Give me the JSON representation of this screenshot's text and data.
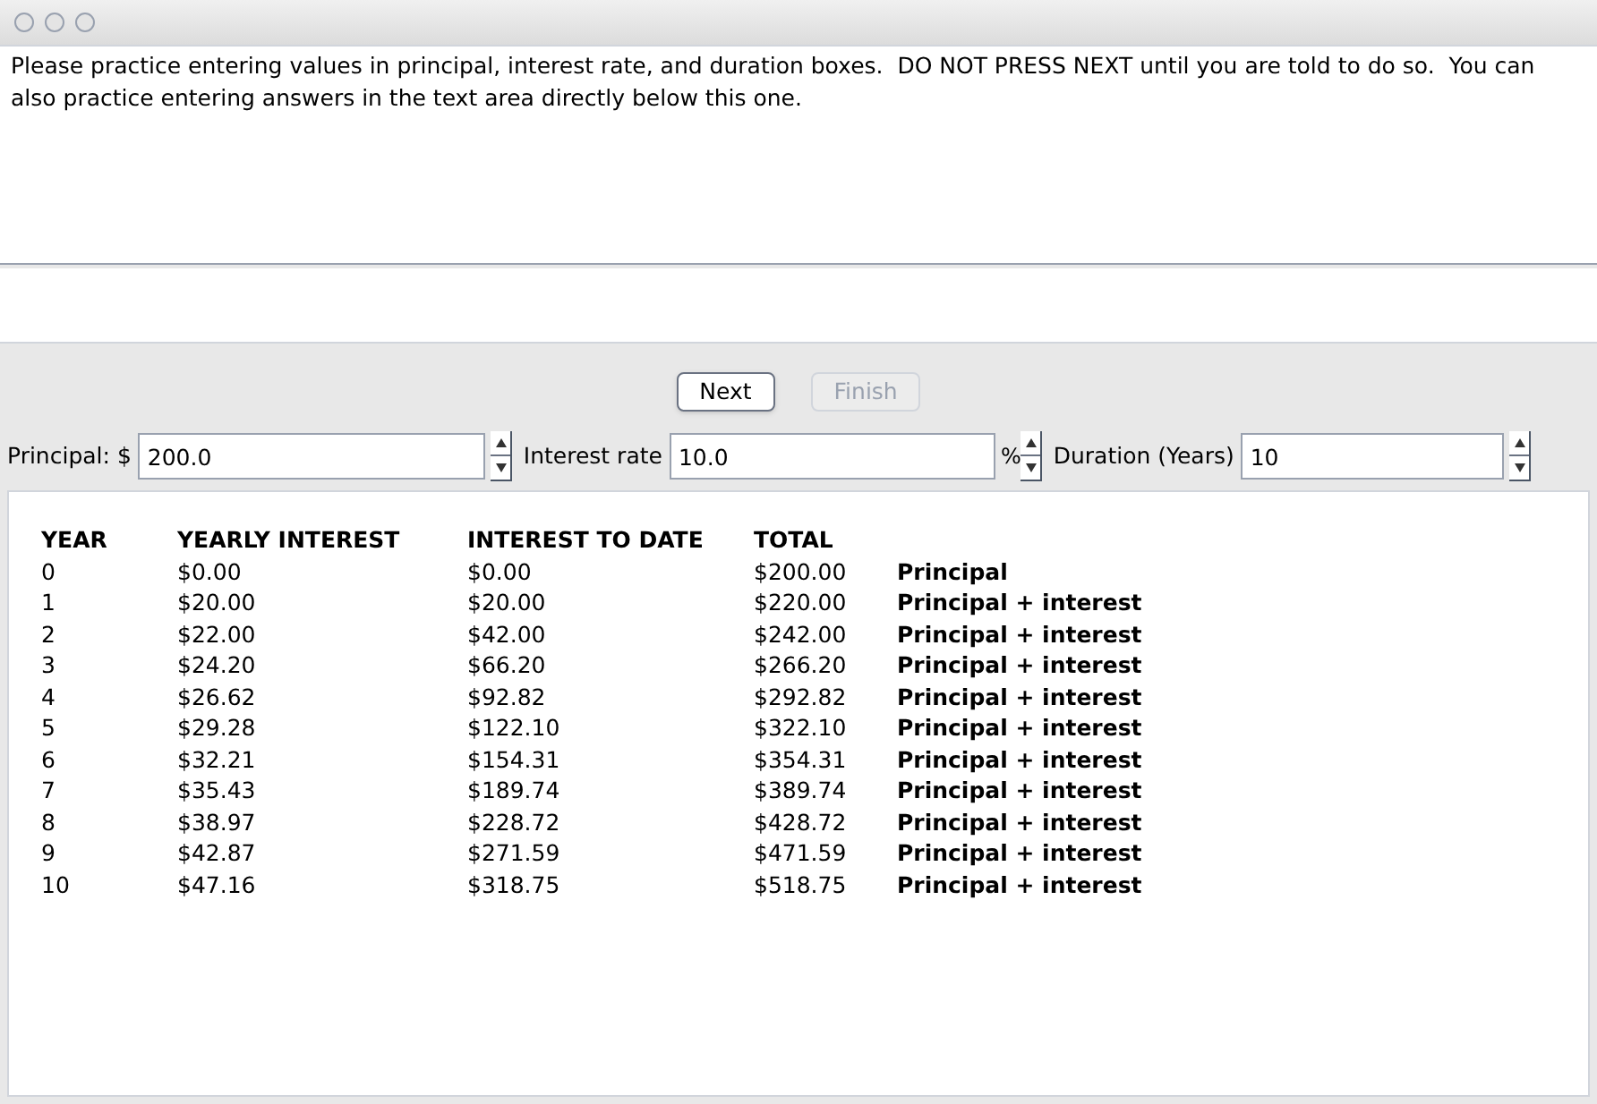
{
  "instructions": "Please practice entering values in principal, interest rate, and duration boxes.  DO NOT PRESS NEXT until you are told to do so.  You can also practice entering answers in the text area directly below this one.",
  "buttons": [
    {
      "label": "Next",
      "disabled": false
    },
    {
      "label": "Finish",
      "disabled": true
    }
  ],
  "inputs": [
    {
      "label": "Principal: $",
      "value": "200.0"
    },
    {
      "label": "Interest rate",
      "value": "10.0",
      "unit": "%"
    },
    {
      "label": "Duration (Years)",
      "value": "10"
    }
  ],
  "table": {
    "columns": [
      "YEAR",
      "YEARLY INTEREST",
      "INTEREST TO DATE",
      "TOTAL"
    ],
    "rows": [
      [
        "0",
        "$0.00",
        "$0.00",
        "$200.00",
        "Principal"
      ],
      [
        "1",
        "$20.00",
        "$20.00",
        "$220.00",
        "Principal + interest"
      ],
      [
        "2",
        "$22.00",
        "$42.00",
        "$242.00",
        "Principal + interest"
      ],
      [
        "3",
        "$24.20",
        "$66.20",
        "$266.20",
        "Principal + interest"
      ],
      [
        "4",
        "$26.62",
        "$92.82",
        "$292.82",
        "Principal + interest"
      ],
      [
        "5",
        "$29.28",
        "$122.10",
        "$322.10",
        "Principal + interest"
      ],
      [
        "6",
        "$32.21",
        "$154.31",
        "$354.31",
        "Principal + interest"
      ],
      [
        "7",
        "$35.43",
        "$189.74",
        "$389.74",
        "Principal + interest"
      ],
      [
        "8",
        "$38.97",
        "$228.72",
        "$428.72",
        "Principal + interest"
      ],
      [
        "9",
        "$42.87",
        "$271.59",
        "$471.59",
        "Principal + interest"
      ],
      [
        "10",
        "$47.16",
        "$318.75",
        "$518.75",
        "Principal + interest"
      ]
    ]
  }
}
